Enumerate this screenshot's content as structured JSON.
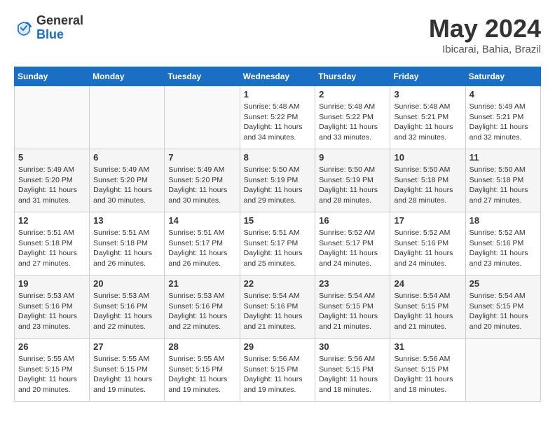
{
  "header": {
    "logo_general": "General",
    "logo_blue": "Blue",
    "month_title": "May 2024",
    "location": "Ibicarai, Bahia, Brazil"
  },
  "weekdays": [
    "Sunday",
    "Monday",
    "Tuesday",
    "Wednesday",
    "Thursday",
    "Friday",
    "Saturday"
  ],
  "weeks": [
    [
      {
        "day": "",
        "info": ""
      },
      {
        "day": "",
        "info": ""
      },
      {
        "day": "",
        "info": ""
      },
      {
        "day": "1",
        "info": "Sunrise: 5:48 AM\nSunset: 5:22 PM\nDaylight: 11 hours and 34 minutes."
      },
      {
        "day": "2",
        "info": "Sunrise: 5:48 AM\nSunset: 5:22 PM\nDaylight: 11 hours and 33 minutes."
      },
      {
        "day": "3",
        "info": "Sunrise: 5:48 AM\nSunset: 5:21 PM\nDaylight: 11 hours and 32 minutes."
      },
      {
        "day": "4",
        "info": "Sunrise: 5:49 AM\nSunset: 5:21 PM\nDaylight: 11 hours and 32 minutes."
      }
    ],
    [
      {
        "day": "5",
        "info": "Sunrise: 5:49 AM\nSunset: 5:20 PM\nDaylight: 11 hours and 31 minutes."
      },
      {
        "day": "6",
        "info": "Sunrise: 5:49 AM\nSunset: 5:20 PM\nDaylight: 11 hours and 30 minutes."
      },
      {
        "day": "7",
        "info": "Sunrise: 5:49 AM\nSunset: 5:20 PM\nDaylight: 11 hours and 30 minutes."
      },
      {
        "day": "8",
        "info": "Sunrise: 5:50 AM\nSunset: 5:19 PM\nDaylight: 11 hours and 29 minutes."
      },
      {
        "day": "9",
        "info": "Sunrise: 5:50 AM\nSunset: 5:19 PM\nDaylight: 11 hours and 28 minutes."
      },
      {
        "day": "10",
        "info": "Sunrise: 5:50 AM\nSunset: 5:18 PM\nDaylight: 11 hours and 28 minutes."
      },
      {
        "day": "11",
        "info": "Sunrise: 5:50 AM\nSunset: 5:18 PM\nDaylight: 11 hours and 27 minutes."
      }
    ],
    [
      {
        "day": "12",
        "info": "Sunrise: 5:51 AM\nSunset: 5:18 PM\nDaylight: 11 hours and 27 minutes."
      },
      {
        "day": "13",
        "info": "Sunrise: 5:51 AM\nSunset: 5:18 PM\nDaylight: 11 hours and 26 minutes."
      },
      {
        "day": "14",
        "info": "Sunrise: 5:51 AM\nSunset: 5:17 PM\nDaylight: 11 hours and 26 minutes."
      },
      {
        "day": "15",
        "info": "Sunrise: 5:51 AM\nSunset: 5:17 PM\nDaylight: 11 hours and 25 minutes."
      },
      {
        "day": "16",
        "info": "Sunrise: 5:52 AM\nSunset: 5:17 PM\nDaylight: 11 hours and 24 minutes."
      },
      {
        "day": "17",
        "info": "Sunrise: 5:52 AM\nSunset: 5:16 PM\nDaylight: 11 hours and 24 minutes."
      },
      {
        "day": "18",
        "info": "Sunrise: 5:52 AM\nSunset: 5:16 PM\nDaylight: 11 hours and 23 minutes."
      }
    ],
    [
      {
        "day": "19",
        "info": "Sunrise: 5:53 AM\nSunset: 5:16 PM\nDaylight: 11 hours and 23 minutes."
      },
      {
        "day": "20",
        "info": "Sunrise: 5:53 AM\nSunset: 5:16 PM\nDaylight: 11 hours and 22 minutes."
      },
      {
        "day": "21",
        "info": "Sunrise: 5:53 AM\nSunset: 5:16 PM\nDaylight: 11 hours and 22 minutes."
      },
      {
        "day": "22",
        "info": "Sunrise: 5:54 AM\nSunset: 5:16 PM\nDaylight: 11 hours and 21 minutes."
      },
      {
        "day": "23",
        "info": "Sunrise: 5:54 AM\nSunset: 5:15 PM\nDaylight: 11 hours and 21 minutes."
      },
      {
        "day": "24",
        "info": "Sunrise: 5:54 AM\nSunset: 5:15 PM\nDaylight: 11 hours and 21 minutes."
      },
      {
        "day": "25",
        "info": "Sunrise: 5:54 AM\nSunset: 5:15 PM\nDaylight: 11 hours and 20 minutes."
      }
    ],
    [
      {
        "day": "26",
        "info": "Sunrise: 5:55 AM\nSunset: 5:15 PM\nDaylight: 11 hours and 20 minutes."
      },
      {
        "day": "27",
        "info": "Sunrise: 5:55 AM\nSunset: 5:15 PM\nDaylight: 11 hours and 19 minutes."
      },
      {
        "day": "28",
        "info": "Sunrise: 5:55 AM\nSunset: 5:15 PM\nDaylight: 11 hours and 19 minutes."
      },
      {
        "day": "29",
        "info": "Sunrise: 5:56 AM\nSunset: 5:15 PM\nDaylight: 11 hours and 19 minutes."
      },
      {
        "day": "30",
        "info": "Sunrise: 5:56 AM\nSunset: 5:15 PM\nDaylight: 11 hours and 18 minutes."
      },
      {
        "day": "31",
        "info": "Sunrise: 5:56 AM\nSunset: 5:15 PM\nDaylight: 11 hours and 18 minutes."
      },
      {
        "day": "",
        "info": ""
      }
    ]
  ]
}
